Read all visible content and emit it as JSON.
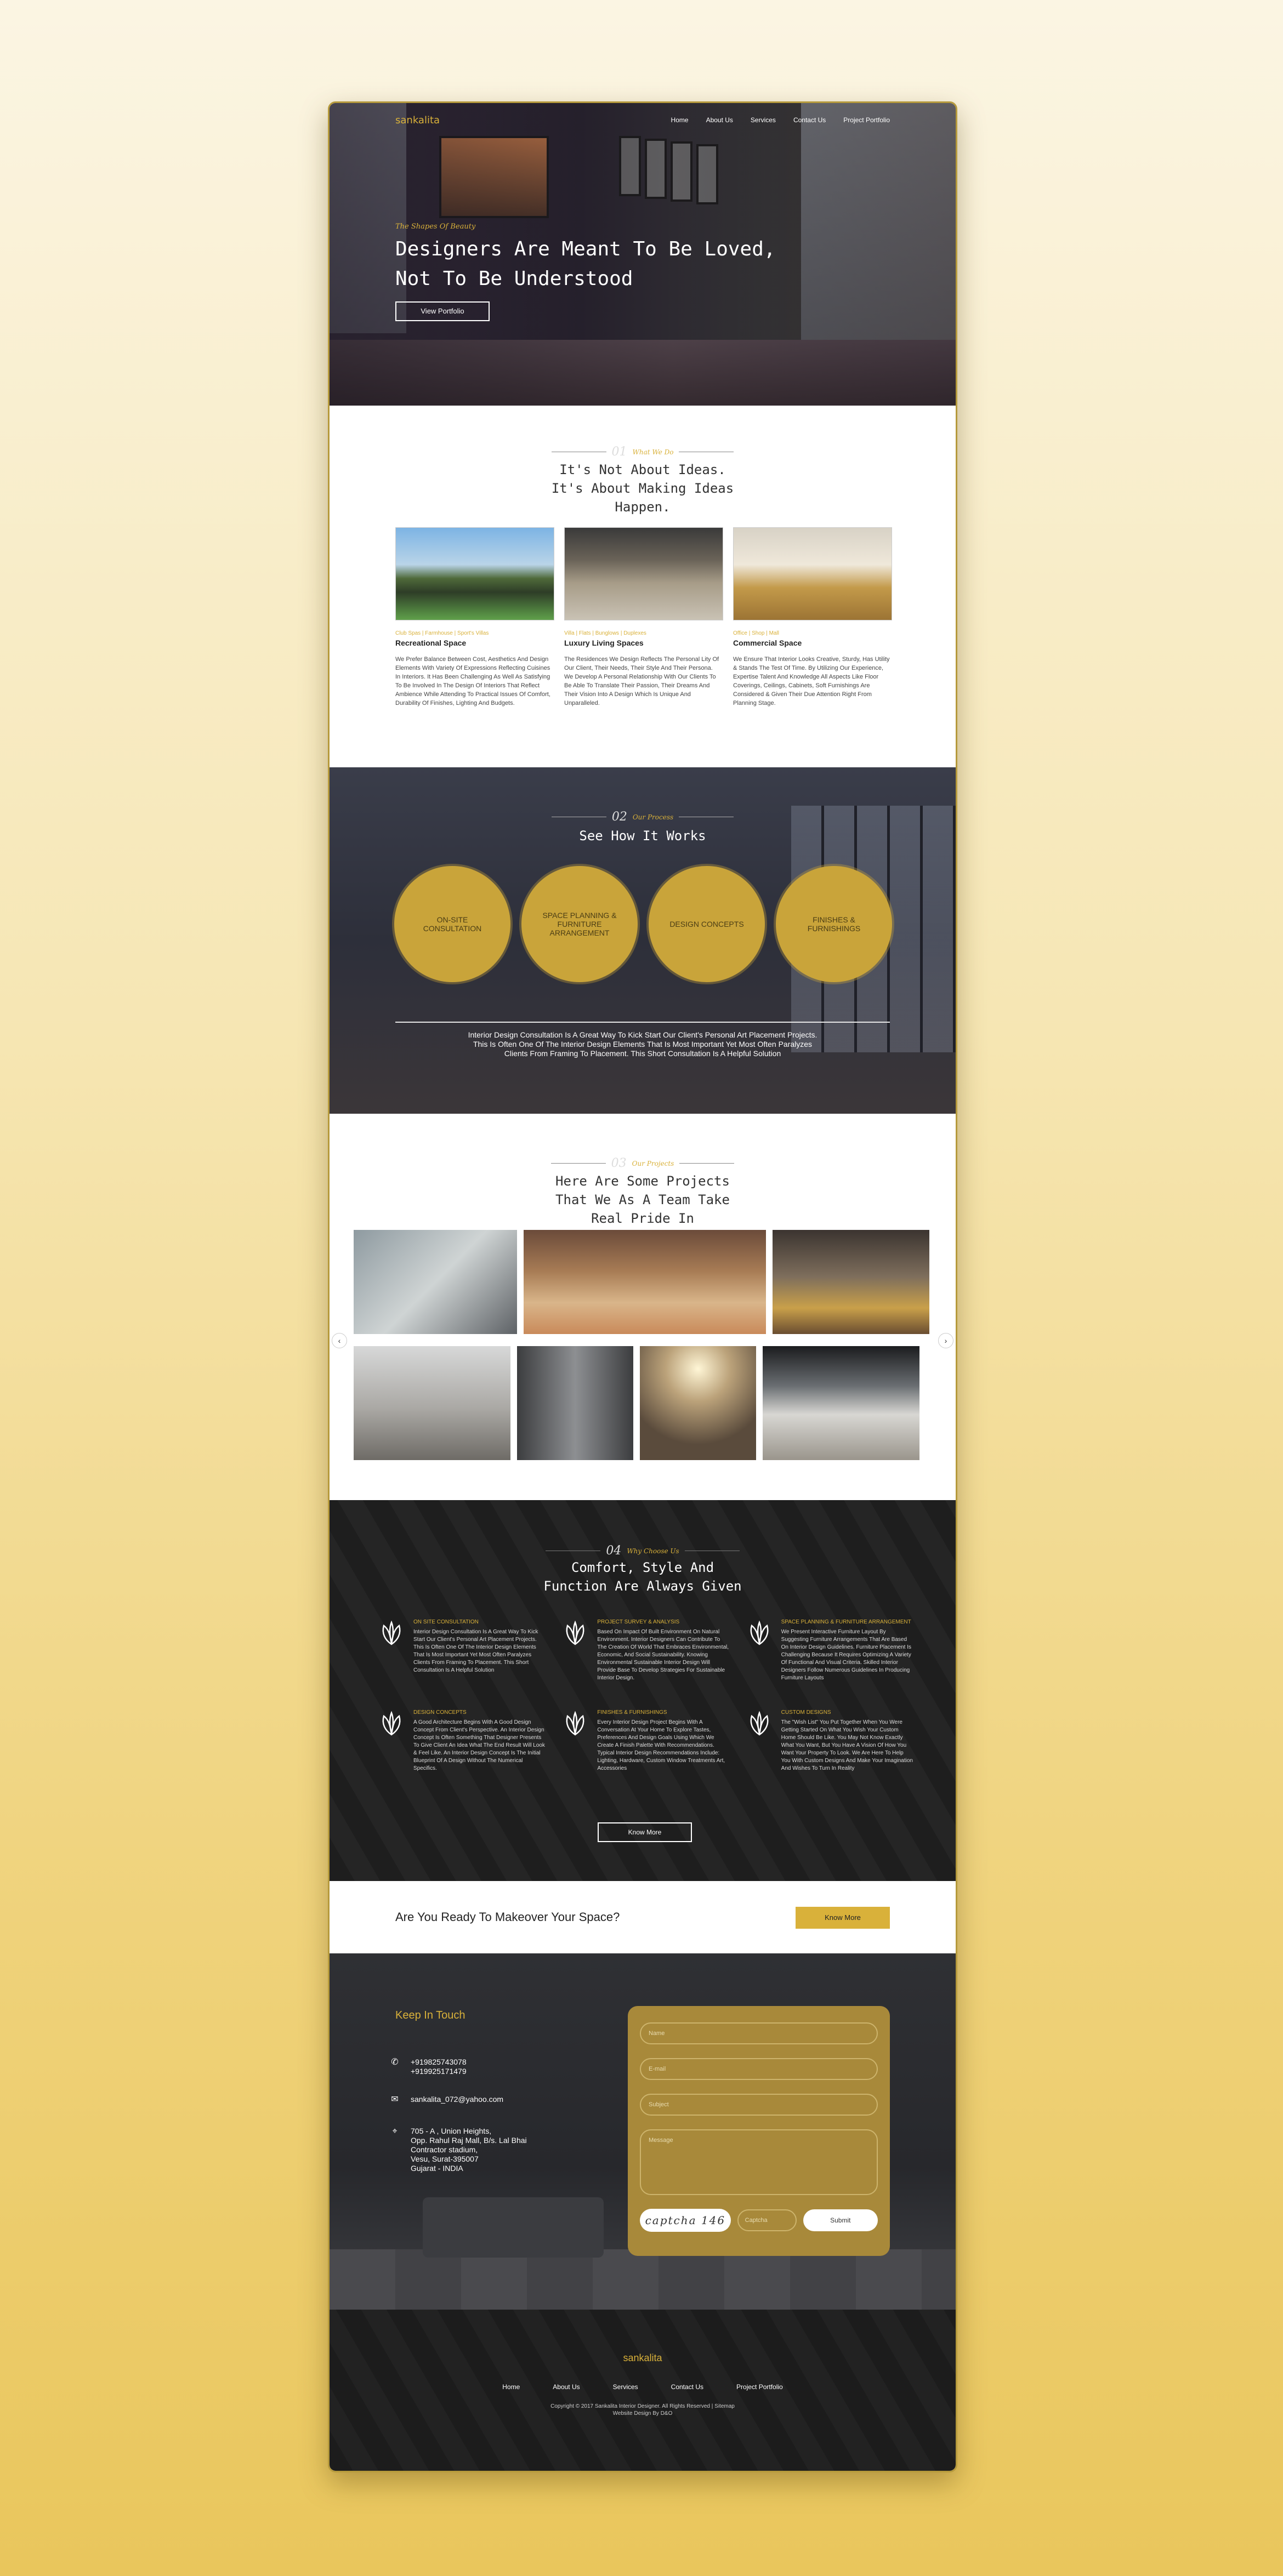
{
  "brand": {
    "logo": "sankalita"
  },
  "nav": {
    "items": [
      "Home",
      "About Us",
      "Services",
      "Contact Us",
      "Project Portfolio"
    ]
  },
  "hero": {
    "tagline": "The Shapes Of Beauty",
    "title": "Designers Are Meant To Be Loved, Not To Be Understood",
    "button": "View Portfolio"
  },
  "what": {
    "num": "01",
    "label": "What We Do",
    "title": "It's Not About Ideas. It's About Making Ideas Happen.",
    "cards": [
      {
        "category": "Club Spas | Farmhouse | Sport's Villas",
        "title": "Recreational Space",
        "desc": "We Prefer Balance Between Cost, Aesthetics And Design Elements With Variety Of Expressions Reflecting Cuisines In Interiors. It Has Been Challenging As Well As Satisfying To Be Involved In The Design Of Interiors That Reflect Ambience While Attending To Practical Issues Of Comfort, Durability Of Finishes, Lighting And Budgets."
      },
      {
        "category": "Villa | Flats | Bunglows | Duplexes",
        "title": "Luxury Living Spaces",
        "desc": "The Residences We Design Reflects The Personal Lity Of Our Client, Their Needs, Their Style And Their Persona. We Develop A Personal Relationship With Our Clients To Be Able To Translate Their Passion, Their Dreams And Their Vision Into A Design Which Is Unique And Unparalleled."
      },
      {
        "category": "Office | Shop | Mall",
        "title": "Commercial Space",
        "desc": "We Ensure That Interior Looks Creative, Sturdy, Has Utility & Stands The Test Of Time. By Utilizing Our Experience, Expertise Talent And Knowledge All Aspects Like Floor Coverings, Ceilings, Cabinets, Soft Furnishings Are Considered & Given Their Due Attention Right From Planning Stage."
      }
    ]
  },
  "process": {
    "num": "02",
    "label": "Our Process",
    "title": "See How It Works",
    "steps": [
      "ON-SITE CONSULTATION",
      "SPACE PLANNING & FURNITURE ARRANGEMENT",
      "DESIGN CONCEPTS",
      "FINISHES & FURNISHINGS"
    ],
    "desc": "Interior Design Consultation Is A Great Way To Kick Start Our Client's Personal Art Placement Projects. This Is Often One Of The Interior Design Elements That Is Most Important Yet Most Often Paralyzes Clients From Framing To Placement. This Short Consultation Is A Helpful Solution"
  },
  "projects": {
    "num": "03",
    "label": "Our Projects",
    "title": "Here Are Some Projects That We As A Team Take Real Pride In",
    "prev": "‹",
    "next": "›"
  },
  "why": {
    "num": "04",
    "label": "Why Choose Us",
    "title": "Comfort, Style And Function Are Always Given",
    "features": [
      {
        "title": "ON SITE CONSULTATION",
        "text": "Interior Design Consultation Is A Great Way To Kick Start Our Client's Personal Art Placement Projects. This Is Often One Of The Interior Design Elements That Is Most Important Yet Most Often Paralyzes Clients From Framing To Placement. This Short Consultation Is A Helpful Solution"
      },
      {
        "title": "PROJECT SURVEY & ANALYSIS",
        "text": "Based On Impact Of Built Environment On Natural Environment. Interior Designers Can Contribute To The Creation Of World That Embraces Environmental, Economic, And Social Sustainability. Knowing Environmental Sustainable Interior Design Will Provide Base To Develop Strategies For Sustainable Interior Design."
      },
      {
        "title": "SPACE PLANNING & FURNITURE ARRANGEMENT",
        "text": "We Present Interactive Furniture Layout By Suggesting Furniture Arrangements That Are Based On Interior Design Guidelines. Furniture Placement Is Challenging Because It Requires Optimizing A Variety Of Functional And Visual Criteria. Skilled Interior Designers Follow Numerous Guidelines In Producing Furniture Layouts"
      },
      {
        "title": "DESIGN CONCEPTS",
        "text": "A Good Architecture Begins With A Good Design Concept From Client's Perspective. An Interior Design Concept Is Often Something That Designer Presents To Give Client An Idea What The End Result Will Look & Feel Like. An Interior Design Concept Is The Initial Blueprint Of A Design Without The Numerical Specifics."
      },
      {
        "title": "FINISHES & FURNISHINGS",
        "text": "Every Interior Design Project Begins With A Conversation At Your Home To Explore Tastes, Preferences And Design Goals Using Which We Create A Finish Palette With Recommendations. Typical Interior Design Recommendations Include: Lighting, Hardware, Custom Window Treatments Art, Accessories"
      },
      {
        "title": "CUSTOM DESIGNS",
        "text": "The \"Wish List\" You Put Together When You Were Getting Started On What You Wish Your Custom Home Should Be Like. You May Not Know Exactly What You Want, But You Have A Vision Of How You Want Your Property To Look. We Are Here To Help You With Custom Designs And Make Your Imagination And Wishes To Turn In Reality"
      }
    ],
    "button": "Know More"
  },
  "cta": {
    "question": "Are You Ready To Makeover Your Space?",
    "button": "Know More"
  },
  "contact": {
    "heading": "Keep In Touch",
    "phones": "+919825743078\n+919925171479",
    "email": "sankalita_072@yahoo.com",
    "address": "705 - A , Union Heights,\nOpp. Rahul Raj Mall, B/s. Lal Bhai\nContractor stadium,\nVesu, Surat-395007\nGujarat - INDIA",
    "form": {
      "name": "Name",
      "email": "E-mail",
      "subject": "Subject",
      "message": "Message",
      "captcha_image": "captcha 146",
      "captcha": "Captcha",
      "submit": "Submit"
    }
  },
  "footer": {
    "logo": "sankalita",
    "links": [
      "Home",
      "About Us",
      "Services",
      "Contact Us",
      "Project Portfolio"
    ],
    "copyright": "Copyright © 2017 Sankalita Interior Designer. All Rights Reserved  |  Sitemap",
    "credit": "Website Design By D&O"
  },
  "colors": {
    "accent": "#d9b13a",
    "dark": "#202020"
  }
}
